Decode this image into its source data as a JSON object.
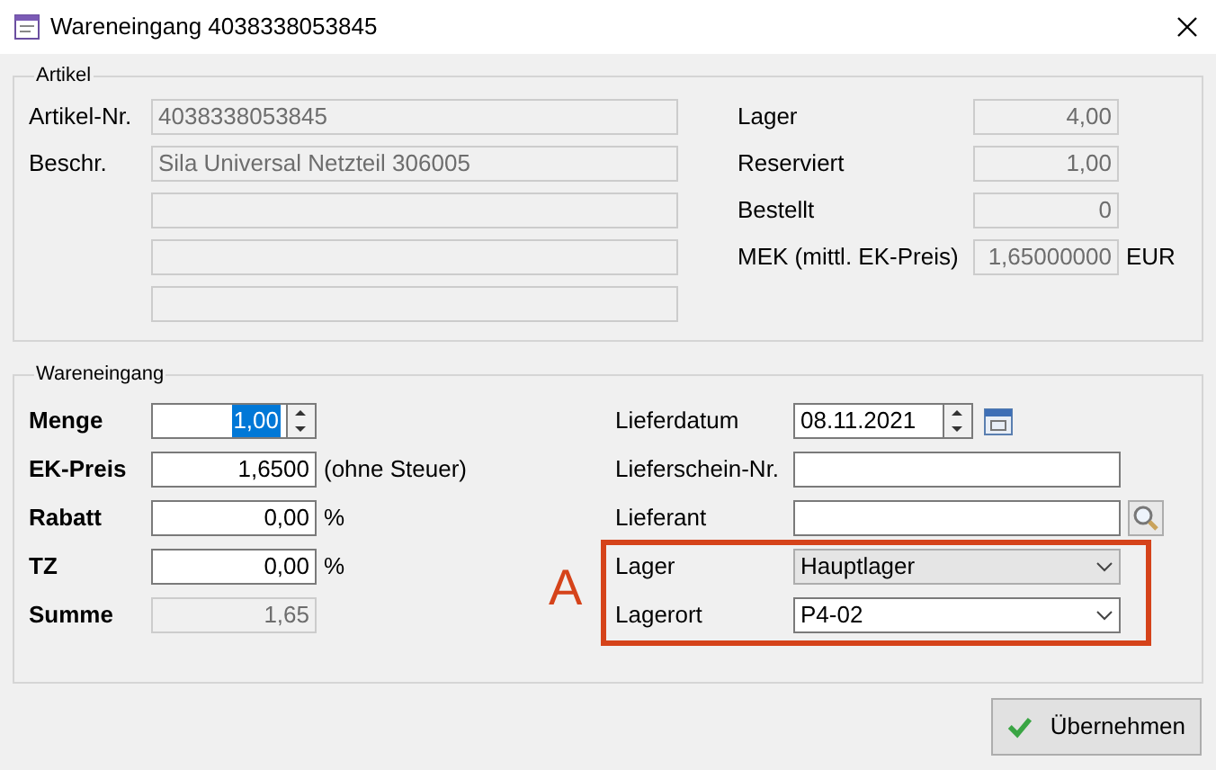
{
  "window": {
    "title": "Wareneingang 4038338053845"
  },
  "artikel": {
    "legend": "Artikel",
    "left": [
      {
        "kind": "labeled",
        "label": "Artikel-Nr.",
        "value": "4038338053845",
        "disabled": true
      },
      {
        "kind": "labeled",
        "label": "Beschr.",
        "value": "Sila Universal Netzteil 306005",
        "disabled": true
      },
      {
        "kind": "blank",
        "disabled": true
      },
      {
        "kind": "blank",
        "disabled": true
      },
      {
        "kind": "blank",
        "disabled": true
      }
    ],
    "right": [
      {
        "label": "Lager",
        "value": "4,00",
        "disabled": true
      },
      {
        "label": "Reserviert",
        "value": "1,00",
        "disabled": true
      },
      {
        "label": "Bestellt",
        "value": "0",
        "disabled": true
      },
      {
        "label": "MEK (mittl. EK-Preis)",
        "value": "1,65000000",
        "unit": "EUR",
        "disabled": true
      }
    ]
  },
  "wareneingang": {
    "legend": "Wareneingang",
    "left": [
      {
        "kind": "spin",
        "label": "Menge",
        "value": "1,00",
        "text_selected": true,
        "disabled": false
      },
      {
        "kind": "number",
        "label": "EK-Preis",
        "value": "1,6500",
        "suffix": "(ohne Steuer)",
        "disabled": false
      },
      {
        "kind": "number",
        "label": "Rabatt",
        "value": "0,00",
        "suffix": "%",
        "disabled": false
      },
      {
        "kind": "number",
        "label": "TZ",
        "value": "0,00",
        "suffix": "%",
        "disabled": false
      },
      {
        "kind": "number",
        "label": "Summe",
        "value": "1,65",
        "disabled": true
      }
    ],
    "right": [
      {
        "kind": "date",
        "label": "Lieferdatum",
        "value": "08.11.2021",
        "annotated": false
      },
      {
        "kind": "text",
        "label": "Lieferschein-Nr.",
        "annotated": false
      },
      {
        "kind": "search",
        "label": "Lieferant",
        "annotated": false
      },
      {
        "kind": "list",
        "label": "Lager",
        "value": "Hauptlager",
        "annotated": true
      },
      {
        "kind": "combo",
        "label": "Lagerort",
        "value": "P4-02",
        "annotated": true
      }
    ],
    "annotation": {
      "label": "A",
      "color": "#d5431a"
    }
  },
  "buttons": [
    {
      "label": "Übernehmen"
    }
  ]
}
